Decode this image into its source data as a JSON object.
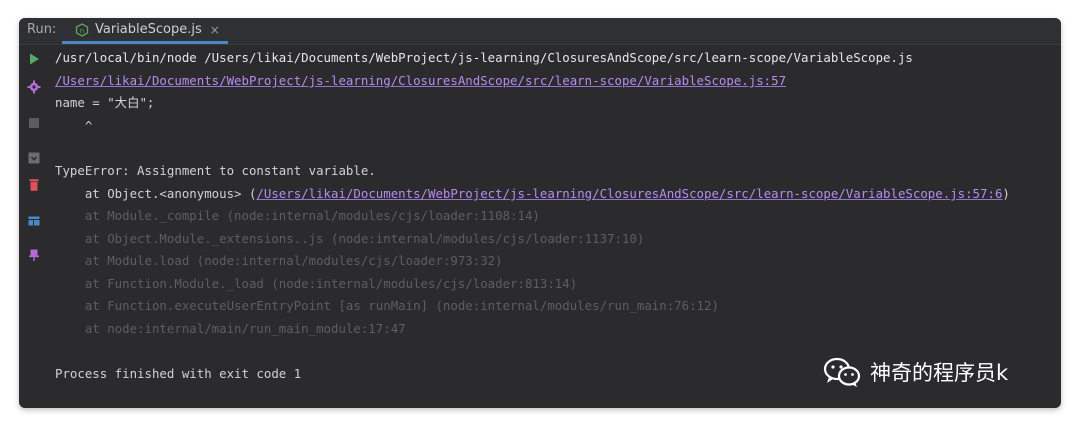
{
  "toolbar": {
    "run_label": "Run:"
  },
  "tab": {
    "label": "VariableScope.js",
    "close": "×"
  },
  "icons": {
    "tab": "nodejs-file-icon",
    "run": "play-icon",
    "settings": "gear-icon",
    "stop": "stop-icon",
    "import": "import-icon",
    "delete": "trash-icon",
    "layout": "layout-icon",
    "pin": "pin-icon"
  },
  "colors": {
    "link": "#b78cf0",
    "dim": "#5c5e61",
    "accent": "#4a88c7",
    "run_green": "#59a869"
  },
  "console": {
    "command": "/usr/local/bin/node /Users/likai/Documents/WebProject/js-learning/ClosuresAndScope/src/learn-scope/VariableScope.js",
    "error_location": "/Users/likai/Documents/WebProject/js-learning/ClosuresAndScope/src/learn-scope/VariableScope.js:57",
    "source_line": "name = \"大白\";",
    "caret": "    ^",
    "error_message": "TypeError: Assignment to constant variable.",
    "stack_first_prefix": "    at Object.<anonymous> (",
    "stack_first_link": "/Users/likai/Documents/WebProject/js-learning/ClosuresAndScope/src/learn-scope/VariableScope.js:57:6",
    "stack_first_suffix": ")",
    "stack_dim": [
      "    at Module._compile (node:internal/modules/cjs/loader:1108:14)",
      "    at Object.Module._extensions..js (node:internal/modules/cjs/loader:1137:10)",
      "    at Module.load (node:internal/modules/cjs/loader:973:32)",
      "    at Function.Module._load (node:internal/modules/cjs/loader:813:14)",
      "    at Function.executeUserEntryPoint [as runMain] (node:internal/modules/run_main:76:12)",
      "    at node:internal/main/run_main_module:17:47"
    ],
    "exit_message": "Process finished with exit code 1"
  },
  "watermark": {
    "text": "神奇的程序员k",
    "icon": "wechat-icon"
  }
}
